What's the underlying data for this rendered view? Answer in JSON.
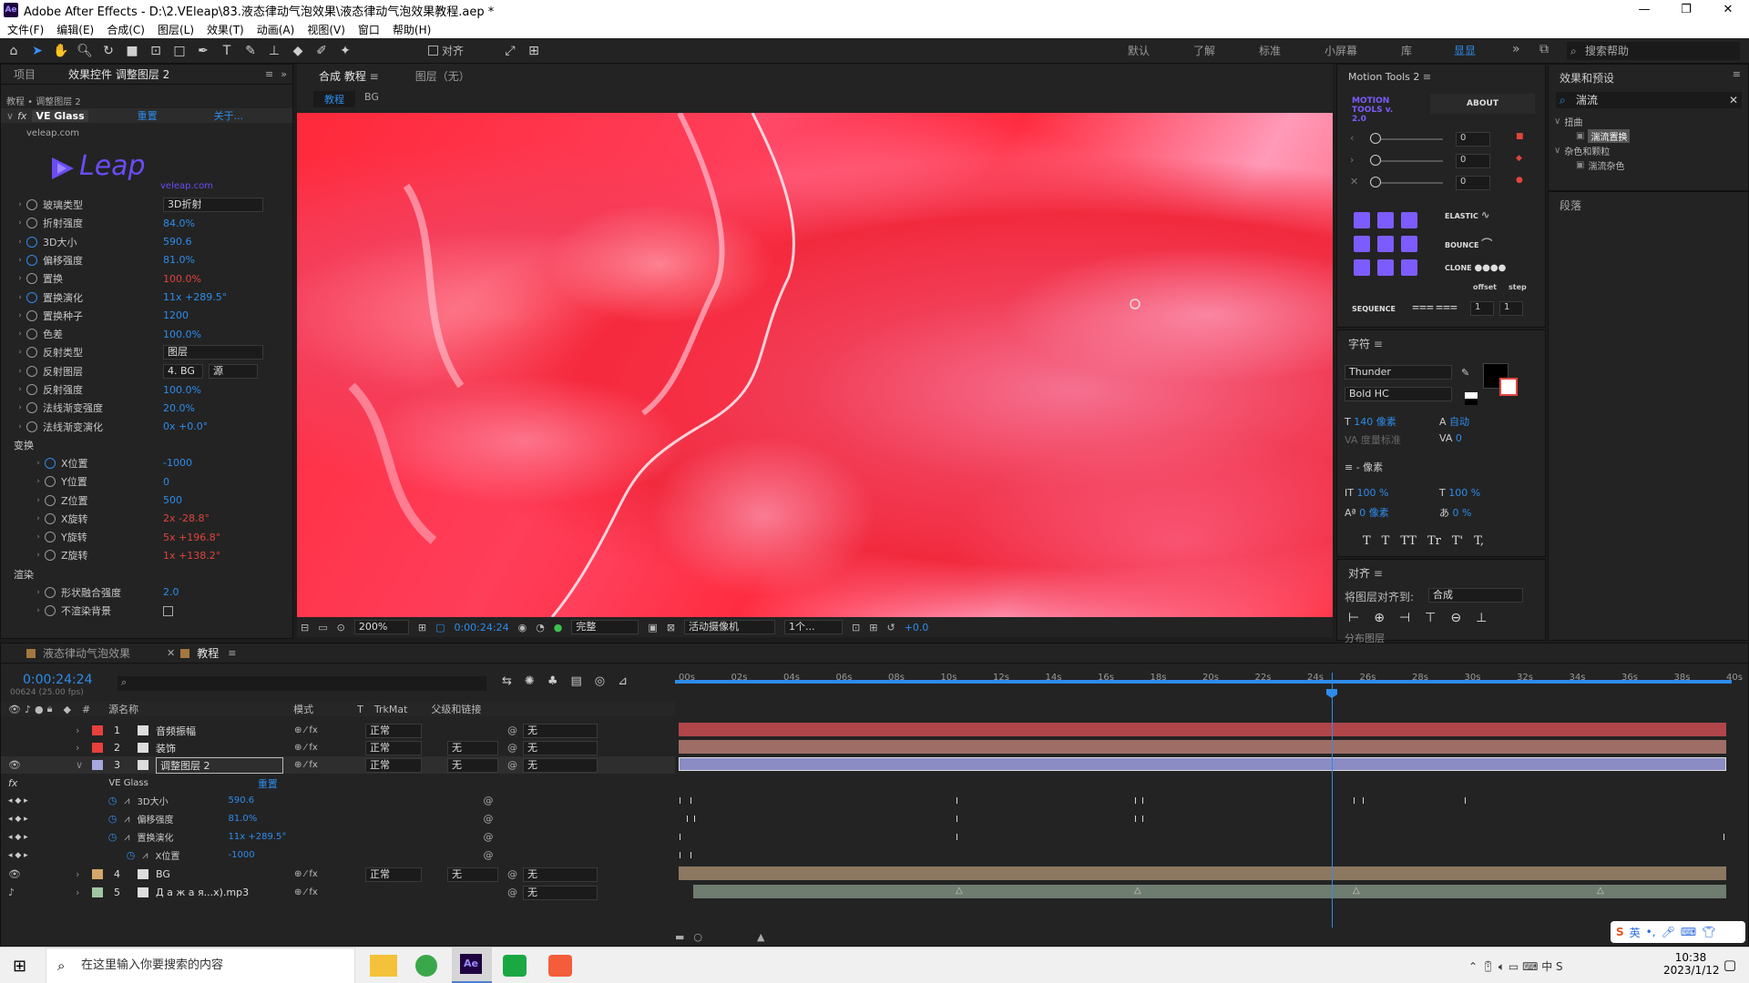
{
  "app": {
    "title": "Adobe After Effects - D:\\2.VEleap\\83.液态律动气泡效果\\液态律动气泡效果教程.aep *",
    "logo_text": "Ae"
  },
  "menu": [
    "文件(F)",
    "编辑(E)",
    "合成(C)",
    "图层(L)",
    "效果(T)",
    "动画(A)",
    "视图(V)",
    "窗口",
    "帮助(H)"
  ],
  "workspaces": [
    {
      "label": "默认",
      "active": false
    },
    {
      "label": "了解",
      "active": false
    },
    {
      "label": "标准",
      "active": false
    },
    {
      "label": "小屏幕",
      "active": false
    },
    {
      "label": "库",
      "active": false
    },
    {
      "label": "显显",
      "active": true
    }
  ],
  "toolbar": {
    "align_label": "对齐",
    "search_help": "搜索帮助"
  },
  "effects_panel": {
    "tabs": [
      "项目",
      "效果控件 调整图层 2"
    ],
    "breadcrumb": "教程 • 调整图层 2",
    "effect_name": "VE Glass",
    "reset": "重置",
    "about": "关于...",
    "site": "veleap.com",
    "logo": "Leap",
    "logo_sub": "veleap.com",
    "props": [
      {
        "label": "玻璃类型",
        "value": "3D折射",
        "type": "select"
      },
      {
        "label": "折射强度",
        "value": "84.0%"
      },
      {
        "label": "3D大小",
        "value": "590.6",
        "keyed": true
      },
      {
        "label": "偏移强度",
        "value": "81.0%",
        "keyed": true
      },
      {
        "label": "置换",
        "value": "100.0%",
        "red": true
      },
      {
        "label": "置换演化",
        "value": "11x +289.5°",
        "keyed": true
      },
      {
        "label": "置换种子",
        "value": "1200"
      },
      {
        "label": "色差",
        "value": "100.0%"
      },
      {
        "label": "反射类型",
        "value": "图层",
        "type": "select"
      },
      {
        "label": "反射图层",
        "value": "4. BG",
        "value2": "源",
        "type": "select2"
      },
      {
        "label": "反射强度",
        "value": "100.0%"
      },
      {
        "label": "法线渐变强度",
        "value": "20.0%"
      },
      {
        "label": "法线渐变演化",
        "value": "0x +0.0°"
      }
    ],
    "transform_group": "变换",
    "transform": [
      {
        "label": "X位置",
        "value": "-1000",
        "keyed": true
      },
      {
        "label": "Y位置",
        "value": "0"
      },
      {
        "label": "Z位置",
        "value": "500"
      },
      {
        "label": "X旋转",
        "value": "2x -28.8°",
        "red": true
      },
      {
        "label": "Y旋转",
        "value": "5x +196.8°",
        "red": true
      },
      {
        "label": "Z旋转",
        "value": "1x +138.2°",
        "red": true
      }
    ],
    "render_group": "渲染",
    "render": [
      {
        "label": "形状融合强度",
        "value": "2.0"
      },
      {
        "label": "不渲染背景",
        "value": ""
      }
    ]
  },
  "composition": {
    "tabs": [
      "合成 教程",
      "图层（无）"
    ],
    "comp_breadcrumb": [
      "教程",
      "BG"
    ],
    "bar": {
      "zoom": "200%",
      "time": "0:00:24:24",
      "quality": "完整",
      "camera": "活动摄像机",
      "views": "1个...",
      "exposure": "+0.0"
    }
  },
  "motion_tools": {
    "title": "Motion Tools 2",
    "logo": "MOTION TOOLS v. 2.0",
    "about": "ABOUT",
    "sliders": [
      "0",
      "0",
      "0"
    ],
    "elastic": "ELASTIC",
    "bounce": "BOUNCE",
    "clone": "CLONE",
    "offset": "offset",
    "step": "step",
    "sequence": "SEQUENCE",
    "seq_values": [
      "1",
      "1"
    ]
  },
  "character": {
    "title": "字符",
    "font": "Thunder",
    "style": "Bold HC",
    "size": "140 像素",
    "leading": "自动",
    "kerning": "度量标准",
    "tracking": "0",
    "stroke": "- 像素",
    "vscale": "100 %",
    "hscale": "100 %",
    "baseline": "0 像素",
    "tsume": "0 %",
    "styles": [
      "T",
      "T",
      "TT",
      "Tr",
      "T'",
      "T,"
    ]
  },
  "align": {
    "title": "对齐",
    "align_to_label": "将图层对齐到:",
    "align_to": "合成",
    "distribute": "分布图层"
  },
  "effects_presets": {
    "title": "效果和预设",
    "search": "湍流",
    "tree": [
      {
        "label": "扭曲",
        "level": 0
      },
      {
        "label": "湍流置换",
        "level": 1,
        "selected": true
      },
      {
        "label": "杂色和颗粒",
        "level": 0
      },
      {
        "label": "湍流杂色",
        "level": 1
      }
    ],
    "paragraph": "段落"
  },
  "timeline": {
    "tabs": [
      "液态律动气泡效果",
      "教程"
    ],
    "timecode": "0:00:24:24",
    "frames": "00624 (25.00 fps)",
    "headers": {
      "name": "源名称",
      "mode": "模式",
      "t": "T",
      "trkmat": "TrkMat",
      "parent": "父级和链接"
    },
    "ruler": [
      "00s",
      "02s",
      "04s",
      "06s",
      "08s",
      "10s",
      "12s",
      "14s",
      "16s",
      "18s",
      "20s",
      "22s",
      "24s",
      "26s",
      "28s",
      "30s",
      "32s",
      "34s",
      "36s",
      "38s",
      "40s"
    ],
    "layers": [
      {
        "num": "1",
        "name": "音频振幅",
        "color": "#e8403c",
        "mode": "正常",
        "trkmat": "",
        "parent": "无"
      },
      {
        "num": "2",
        "name": "装饰",
        "color": "#e8403c",
        "mode": "正常",
        "trkmat": "无",
        "parent": "无"
      },
      {
        "num": "3",
        "name": "调整图层 2",
        "color": "#a6a8e0",
        "mode": "正常",
        "trkmat": "无",
        "parent": "无"
      },
      {
        "num": "4",
        "name": "BG",
        "color": "#d6a66a",
        "mode": "正常",
        "trkmat": "无",
        "parent": "无"
      },
      {
        "num": "5",
        "name": "Д а ж а я...x).mp3",
        "color": "#9fc7a2",
        "mode": "",
        "trkmat": "",
        "parent": "无"
      }
    ],
    "effect_row": {
      "name": "VE Glass",
      "reset": "重置"
    },
    "sub_props": [
      {
        "label": "3D大小",
        "value": "590.6"
      },
      {
        "label": "偏移强度",
        "value": "81.0%"
      },
      {
        "label": "置换演化",
        "value": "11x +289.5°"
      },
      {
        "label": "X位置",
        "value": "-1000"
      }
    ]
  },
  "taskbar": {
    "search_placeholder": "在这里输入你要搜索的内容",
    "time": "10:38",
    "date": "2023/1/12",
    "ime": "英"
  },
  "colors": {
    "accent": "#2d8ceb",
    "panel": "#232323",
    "bg": "#1d1d1d"
  }
}
